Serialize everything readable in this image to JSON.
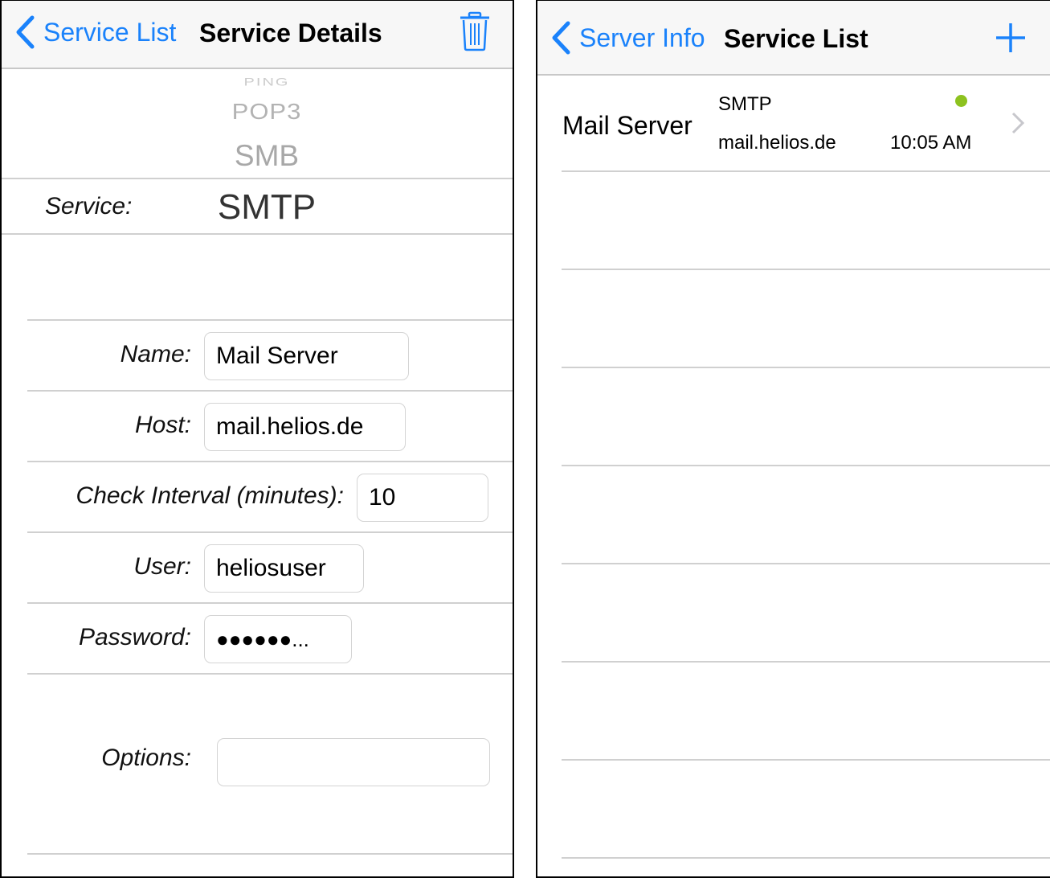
{
  "left_panel": {
    "nav": {
      "back_label": "Service List",
      "title": "Service Details",
      "delete_icon": "trash-icon"
    },
    "picker": {
      "items": [
        "PING",
        "POP3",
        "SMB"
      ],
      "label": "Service:",
      "selected": "SMTP"
    },
    "form": {
      "name_label": "Name:",
      "name_value": "Mail Server",
      "host_label": "Host:",
      "host_value": "mail.helios.de",
      "interval_label": "Check Interval (minutes):",
      "interval_value": "10",
      "user_label": "User:",
      "user_value": "heliosuser",
      "password_label": "Password:",
      "password_value": "●●●●●●...",
      "options_label": "Options:",
      "options_value": ""
    }
  },
  "right_panel": {
    "nav": {
      "back_label": "Server Info",
      "title": "Service List",
      "add_icon": "plus-icon"
    },
    "services": [
      {
        "name": "Mail Server",
        "type": "SMTP",
        "host": "mail.helios.de",
        "time": "10:05 AM",
        "status_color": "#8dc21f"
      }
    ]
  },
  "colors": {
    "accent": "#1a82fb",
    "status_ok": "#8dc21f"
  }
}
